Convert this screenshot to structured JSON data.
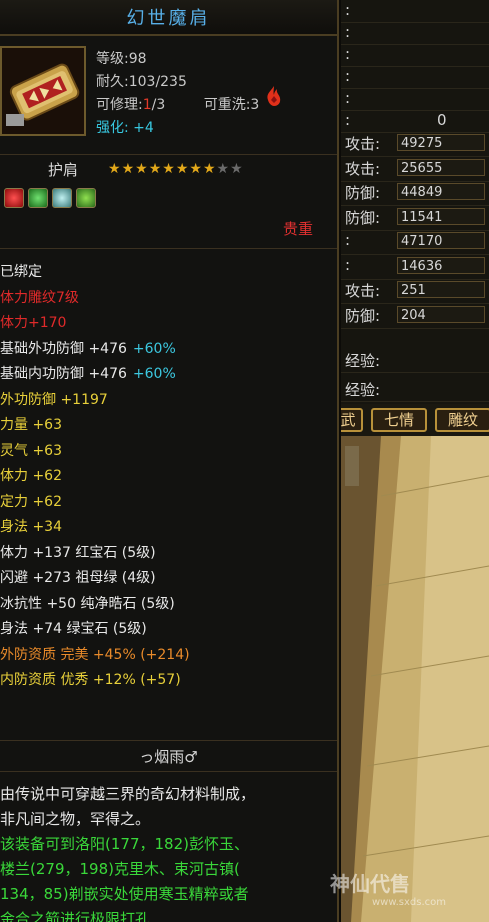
{
  "tooltip": {
    "title": "幻世魔肩",
    "level": "等级:98",
    "durability": "耐久:103/235",
    "repairable_prefix": "可修理:",
    "repairable_cur": "1",
    "repairable_total": "/3",
    "rewash": "可重洗:3",
    "enhance_label": "强化:",
    "enhance_value": "+4",
    "slot": "护肩",
    "stars_on": 8,
    "stars_total": 10,
    "heavy_tag": "贵重",
    "attributes": [
      {
        "text": "已绑定",
        "color": "#e8e8e8"
      },
      {
        "text": "体力雕纹7级",
        "color": "#e02a2a"
      },
      {
        "text": "体力+170",
        "color": "#e02a2a"
      },
      {
        "text": "基础外功防御 +476",
        "extra": "+60%",
        "color": "#e8e8e8",
        "extra_color": "#3cc8e0"
      },
      {
        "text": "基础内功防御 +476",
        "extra": "+60%",
        "color": "#e8e8e8",
        "extra_color": "#3cc8e0"
      },
      {
        "text": "外功防御 +1197",
        "color": "#e8d03a"
      },
      {
        "text": "力量 +63",
        "color": "#e8d03a"
      },
      {
        "text": "灵气 +63",
        "color": "#e8d03a"
      },
      {
        "text": "体力 +62",
        "color": "#e8d03a"
      },
      {
        "text": "定力 +62",
        "color": "#e8d03a"
      },
      {
        "text": "身法 +34",
        "color": "#e8d03a"
      },
      {
        "text": "体力 +137 红宝石 (5级)",
        "color": "#e8e8e8"
      },
      {
        "text": "闪避 +273 祖母绿 (4级)",
        "color": "#e8e8e8"
      },
      {
        "text": "冰抗性 +50 纯净晧石 (5级)",
        "color": "#e8e8e8"
      },
      {
        "text": "身法 +74 绿宝石 (5级)",
        "color": "#e8e8e8"
      },
      {
        "text": "外防资质  完美 +45% (+214)",
        "color": "#e88a2a"
      },
      {
        "text": "内防资质  优秀 +12% (+57)",
        "color": "#e8d03a"
      }
    ],
    "maker": "っ烟雨♂",
    "description": [
      {
        "text": "由传说中可穿越三界的奇幻材料制成，",
        "color": "#e8e8e8"
      },
      {
        "text": "非凡间之物，罕得之。",
        "color": "#e8e8e8"
      },
      {
        "text": "该装备可到洛阳(177，182)彭怀玉、",
        "color": "#3ad83a"
      },
      {
        "text": "楼兰(279，198)克里木、束河古镇(",
        "color": "#3ad83a"
      },
      {
        "text": "134，85)剃嵌实处使用寒玉精粹或者",
        "color": "#3ad83a"
      },
      {
        "text": "金合之箭进行极限打孔",
        "color": "#3ad83a"
      }
    ]
  },
  "right_panel": {
    "rows": [
      {
        "label": ":",
        "value": ""
      },
      {
        "label": ":",
        "value": ""
      },
      {
        "label": ":",
        "value": ""
      },
      {
        "label": ":",
        "value": ""
      },
      {
        "label": ":",
        "value": ""
      },
      {
        "label": ":",
        "value": "0"
      },
      {
        "label": "攻击:",
        "value": "49275"
      },
      {
        "label": "攻击:",
        "value": "25655"
      },
      {
        "label": "防御:",
        "value": "44849"
      },
      {
        "label": "防御:",
        "value": "11541"
      },
      {
        "label": ":",
        "value": "47170"
      },
      {
        "label": ":",
        "value": "14636"
      },
      {
        "label": "攻击:",
        "value": "251"
      },
      {
        "label": "防御:",
        "value": "204"
      }
    ],
    "exp1_label": "经验:",
    "exp2_label": "经验:",
    "tabs": [
      "武",
      "七情",
      "雕纹"
    ]
  },
  "watermark": {
    "brand": "神仙代售",
    "url": "www.sxds.com"
  }
}
